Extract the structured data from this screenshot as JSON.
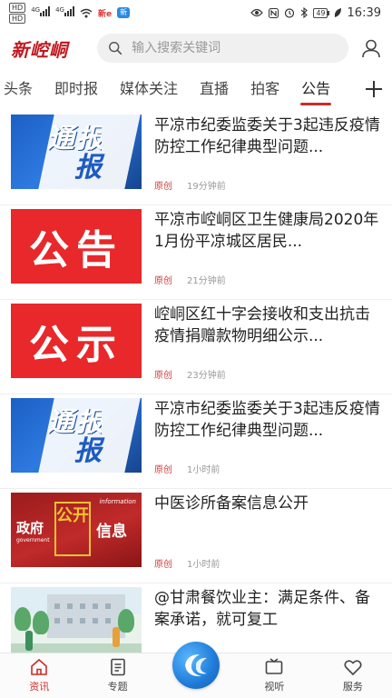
{
  "status_bar": {
    "left_chips": [
      "HD",
      "HD"
    ],
    "network_labels": [
      "4G",
      "4G"
    ],
    "app_badge": "新",
    "right_battery": "49",
    "time": "16:39"
  },
  "header": {
    "logo_text": "新崆峒",
    "search_placeholder": "输入搜索关键词",
    "icons": {
      "search": "search-icon",
      "user": "user-icon"
    }
  },
  "tabs": {
    "items": [
      "头条",
      "即时报",
      "媒体关注",
      "直播",
      "拍客",
      "公告"
    ],
    "active_index": 5,
    "add_icon": "plus-icon"
  },
  "feed": {
    "items": [
      {
        "thumb": "通报",
        "thumb_sub": "报",
        "title": "平凉市纪委监委关于3起违反疫情防控工作纪律典型问题...",
        "source": "原创",
        "time": "19分钟前"
      },
      {
        "thumb": "公告",
        "title": "平凉市崆峒区卫生健康局2020年1月份平凉城区居民...",
        "source": "原创",
        "time": "21分钟前"
      },
      {
        "thumb": "公示",
        "title": "崆峒区红十字会接收和支出抗击疫情捐赠款物明细公示...",
        "source": "原创",
        "time": "23分钟前"
      },
      {
        "thumb": "通报",
        "thumb_sub": "报",
        "title": "平凉市纪委监委关于3起违反疫情防控工作纪律典型问题...",
        "source": "原创",
        "time": "1小时前"
      },
      {
        "thumb_left": "政府",
        "thumb_left_small": "government",
        "thumb_mid": "公开",
        "thumb_right": "信息",
        "thumb_info": "information",
        "title": "中医诊所备案信息公开",
        "source": "原创",
        "time": "1小时前"
      },
      {
        "title": "@甘肃餐饮业主：满足条件、备案承诺，就可复工",
        "source": "",
        "time": ""
      }
    ]
  },
  "bottom_nav": {
    "items": [
      {
        "label": "资讯",
        "icon": "home-icon",
        "active": true
      },
      {
        "label": "专题",
        "icon": "document-icon",
        "active": false
      },
      {
        "label": "",
        "icon": "center-logo-icon",
        "active": false
      },
      {
        "label": "视听",
        "icon": "tv-icon",
        "active": false
      },
      {
        "label": "服务",
        "icon": "heart-icon",
        "active": false
      }
    ]
  },
  "colors": {
    "accent": "#d02a2a",
    "logo": "#c0181f",
    "meta_source": "#d04040"
  }
}
